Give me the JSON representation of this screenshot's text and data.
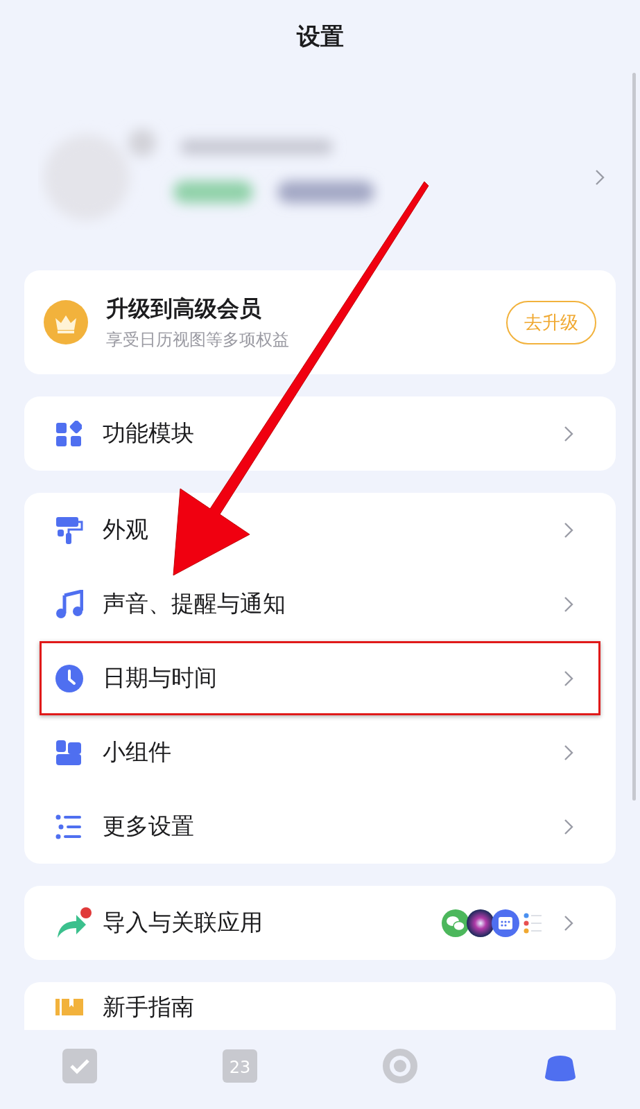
{
  "title": "设置",
  "profile": {
    "kind": "blurred"
  },
  "premium": {
    "title": "升级到高级会员",
    "subtitle": "享受日历视图等多项权益",
    "button": "去升级"
  },
  "groups": [
    {
      "items": [
        {
          "kind": "grid",
          "label": "功能模块",
          "highlighted": false
        }
      ]
    },
    {
      "items": [
        {
          "kind": "brush",
          "label": "外观",
          "highlighted": false
        },
        {
          "kind": "music",
          "label": "声音、提醒与通知",
          "highlighted": false
        },
        {
          "kind": "clock",
          "label": "日期与时间",
          "highlighted": true
        },
        {
          "kind": "widget",
          "label": "小组件",
          "highlighted": false
        },
        {
          "kind": "list",
          "label": "更多设置",
          "highlighted": false
        }
      ]
    },
    {
      "items": [
        {
          "kind": "share",
          "label": "导入与关联应用",
          "highlighted": false,
          "badge": true,
          "apps": [
            {
              "kind": "chat"
            },
            {
              "kind": "orb"
            },
            {
              "kind": "calendar"
            },
            {
              "kind": "list"
            }
          ]
        }
      ]
    }
  ],
  "guide": {
    "kind": "book",
    "label": "新手指南"
  },
  "bottom_nav": [
    {
      "kind": "tasks",
      "selected": false
    },
    {
      "kind": "calendar",
      "label": "23",
      "selected": false
    },
    {
      "kind": "focus",
      "selected": false
    },
    {
      "kind": "profile",
      "selected": true
    }
  ],
  "annotation": {
    "kind": "arrow"
  }
}
